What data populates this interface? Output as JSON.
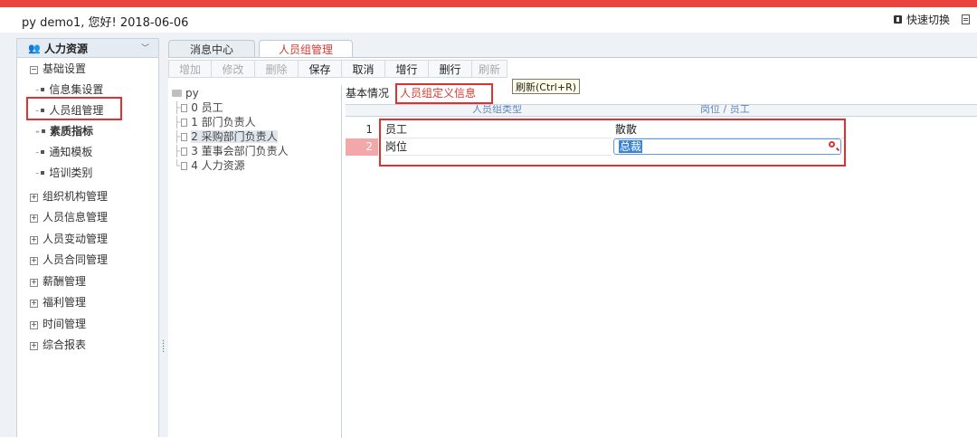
{
  "header": {
    "greeting": "py demo1, 您好! 2018-06-06",
    "quick_switch_label": "快速切换"
  },
  "sidebar": {
    "module_title": "人力资源",
    "groups": [
      {
        "label": "基础设置",
        "expanded": true,
        "children": [
          "信息集设置",
          "人员组管理",
          "素质指标",
          "通知模板",
          "培训类别"
        ]
      },
      {
        "label": "组织机构管理"
      },
      {
        "label": "人员信息管理"
      },
      {
        "label": "人员变动管理"
      },
      {
        "label": "人员合同管理"
      },
      {
        "label": "薪酬管理"
      },
      {
        "label": "福利管理"
      },
      {
        "label": "时间管理"
      },
      {
        "label": "综合报表"
      }
    ]
  },
  "tabs": [
    {
      "label": "消息中心"
    },
    {
      "label": "人员组管理"
    }
  ],
  "toolbar": {
    "buttons": [
      "增加",
      "修改",
      "删除",
      "保存",
      "取消",
      "增行",
      "删行",
      "刷新"
    ],
    "tooltip": "刷新(Ctrl+R)"
  },
  "group_tree": {
    "root": "py",
    "items": [
      "0 员工",
      "1 部门负责人",
      "2 采购部门负责人",
      "3 董事会部门负责人",
      "4 人力资源"
    ]
  },
  "subtabs": [
    "基本情况",
    "人员组定义信息"
  ],
  "grid": {
    "columns": [
      "人员组类型",
      "岗位 / 员工"
    ],
    "rows": [
      {
        "num": "1",
        "type": "员工",
        "value": "散散"
      },
      {
        "num": "2",
        "type": "岗位",
        "value": "总裁"
      }
    ]
  },
  "colors": {
    "accent_red": "#e8453c",
    "highlight_box": "#e03030",
    "selected_row": "#f2a8a8",
    "edit_blue": "#3c84d6"
  }
}
